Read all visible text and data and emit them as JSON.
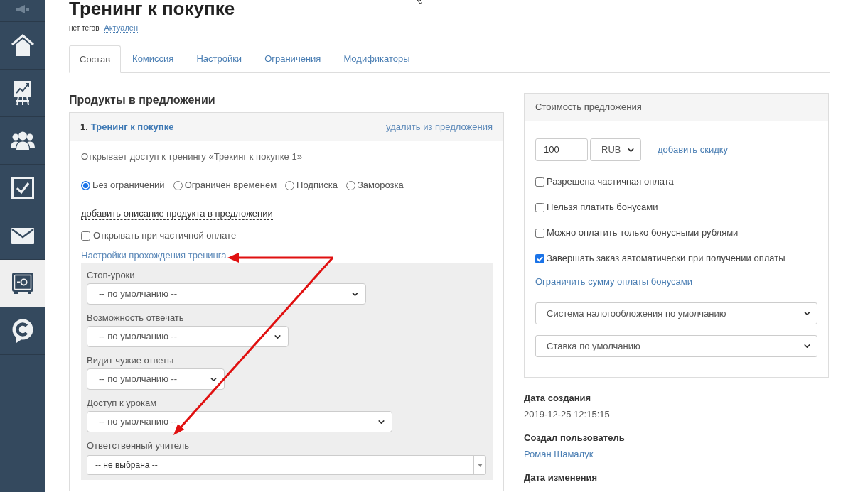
{
  "sidebar": {
    "items": [
      {
        "selected": false
      },
      {
        "selected": false
      },
      {
        "selected": false
      },
      {
        "selected": false
      },
      {
        "selected": false
      },
      {
        "selected": false
      },
      {
        "selected": true
      },
      {
        "selected": false
      }
    ]
  },
  "page": {
    "title": "Тренинг к покупке",
    "tags": "нет тегов",
    "status": "Актуален"
  },
  "tabs": [
    {
      "label": "Состав",
      "selected": true
    },
    {
      "label": "Комиссия",
      "selected": false
    },
    {
      "label": "Настройки",
      "selected": false
    },
    {
      "label": "Ограничения",
      "selected": false
    },
    {
      "label": "Модификаторы",
      "selected": false
    }
  ],
  "products": {
    "heading": "Продукты в предложении",
    "items": [
      {
        "number": "1.",
        "name": "Тренинг к покупке",
        "remove_link": "удалить из предложения",
        "description": "Открывает доступ к тренингу «Трекинг к покупке 1»",
        "access": [
          {
            "label": "Без ограничений",
            "selected": true
          },
          {
            "label": "Ограничен временем",
            "selected": false
          },
          {
            "label": "Подписка",
            "selected": false
          },
          {
            "label": "Заморозка",
            "selected": false
          }
        ],
        "add_description_link": "добавить описание продукта в предложении",
        "open_on_partial": {
          "label": "Открывать при частичной оплате",
          "checked": false
        },
        "settings_link": "Настройки прохождения тренинга",
        "settings": [
          {
            "kind": "select",
            "label": "Стоп-уроки",
            "value": "-- по умолчанию --"
          },
          {
            "kind": "select",
            "label": "Возможность отвечать",
            "value": "-- по умолчанию --"
          },
          {
            "kind": "select",
            "label": "Видит чужие ответы",
            "value": "-- по умолчанию --"
          },
          {
            "kind": "select",
            "label": "Доступ к урокам",
            "value": "-- по умолчанию --"
          },
          {
            "kind": "combobox",
            "label": "Ответственный учитель",
            "value": "-- не выбрана --"
          }
        ]
      }
    ]
  },
  "price": {
    "title": "Стоимость предложения",
    "amount": "100",
    "currency": "RUB",
    "discount_link": "добавить скидку",
    "options": [
      {
        "label": "Разрешена частичная оплата",
        "checked": false
      },
      {
        "label": "Нельзя платить бонусами",
        "checked": false
      },
      {
        "label": "Можно оплатить только бонусными рублями",
        "checked": false
      },
      {
        "label": "Завершать заказ автоматически при получении оплаты",
        "checked": true
      }
    ],
    "bonus_limit_link": "Ограничить сумму оплаты бонусами",
    "selects": [
      "Система налогообложения по умолчанию",
      "Ставка по умолчанию"
    ]
  },
  "details": [
    {
      "kind": "text",
      "label": "Дата создания",
      "value": "2019-12-25 12:15:15"
    },
    {
      "kind": "link",
      "label": "Создал пользователь",
      "value": "Роман Шамалук"
    },
    {
      "label": "Дата изменения"
    }
  ]
}
